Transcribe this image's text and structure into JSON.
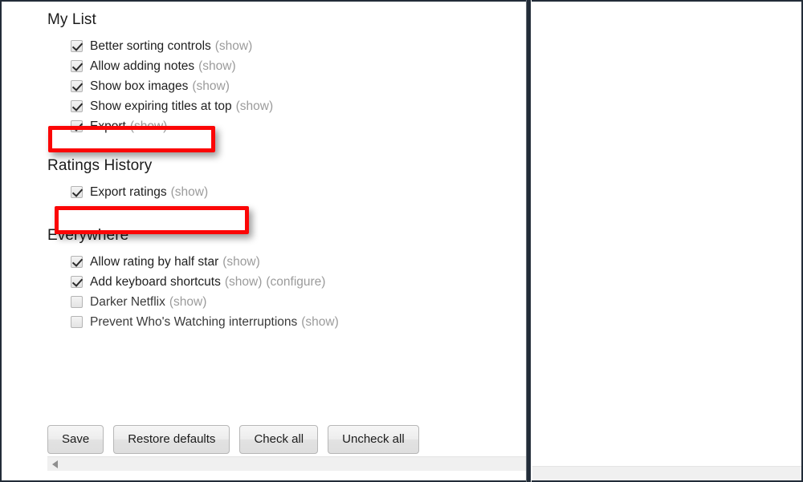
{
  "window": {
    "divider_color": "#222c38",
    "highlight_color": "#fb0606"
  },
  "options_page": {
    "sections": [
      {
        "title": "My List",
        "options": [
          {
            "label": "Better sorting controls",
            "checked": true,
            "links": [
              "(show)"
            ]
          },
          {
            "label": "Allow adding notes",
            "checked": true,
            "links": [
              "(show)"
            ]
          },
          {
            "label": "Show box images",
            "checked": true,
            "links": [
              "(show)"
            ]
          },
          {
            "label": "Show expiring titles at top",
            "checked": true,
            "links": [
              "(show)"
            ]
          },
          {
            "label": "Export",
            "checked": true,
            "links": [
              "(show)"
            ],
            "highlighted": true
          }
        ]
      },
      {
        "title": "Ratings History",
        "options": [
          {
            "label": "Export ratings",
            "checked": true,
            "links": [
              "(show)"
            ],
            "highlighted": true
          }
        ]
      },
      {
        "title": "Everywhere",
        "options": [
          {
            "label": "Allow rating by half star",
            "checked": true,
            "links": [
              "(show)"
            ]
          },
          {
            "label": "Add keyboard shortcuts",
            "checked": true,
            "links": [
              "(show)",
              "(configure)"
            ]
          },
          {
            "label": "Darker Netflix",
            "checked": false,
            "links": [
              "(show)"
            ]
          },
          {
            "label": "Prevent Who's Watching interruptions",
            "checked": false,
            "links": [
              "(show)"
            ]
          }
        ]
      }
    ],
    "buttons": [
      {
        "label": "Save"
      },
      {
        "label": "Restore defaults"
      },
      {
        "label": "Check all"
      },
      {
        "label": "Uncheck all"
      }
    ],
    "scrollbar": {
      "left_arrow_icon": "triangle-left-icon"
    }
  }
}
